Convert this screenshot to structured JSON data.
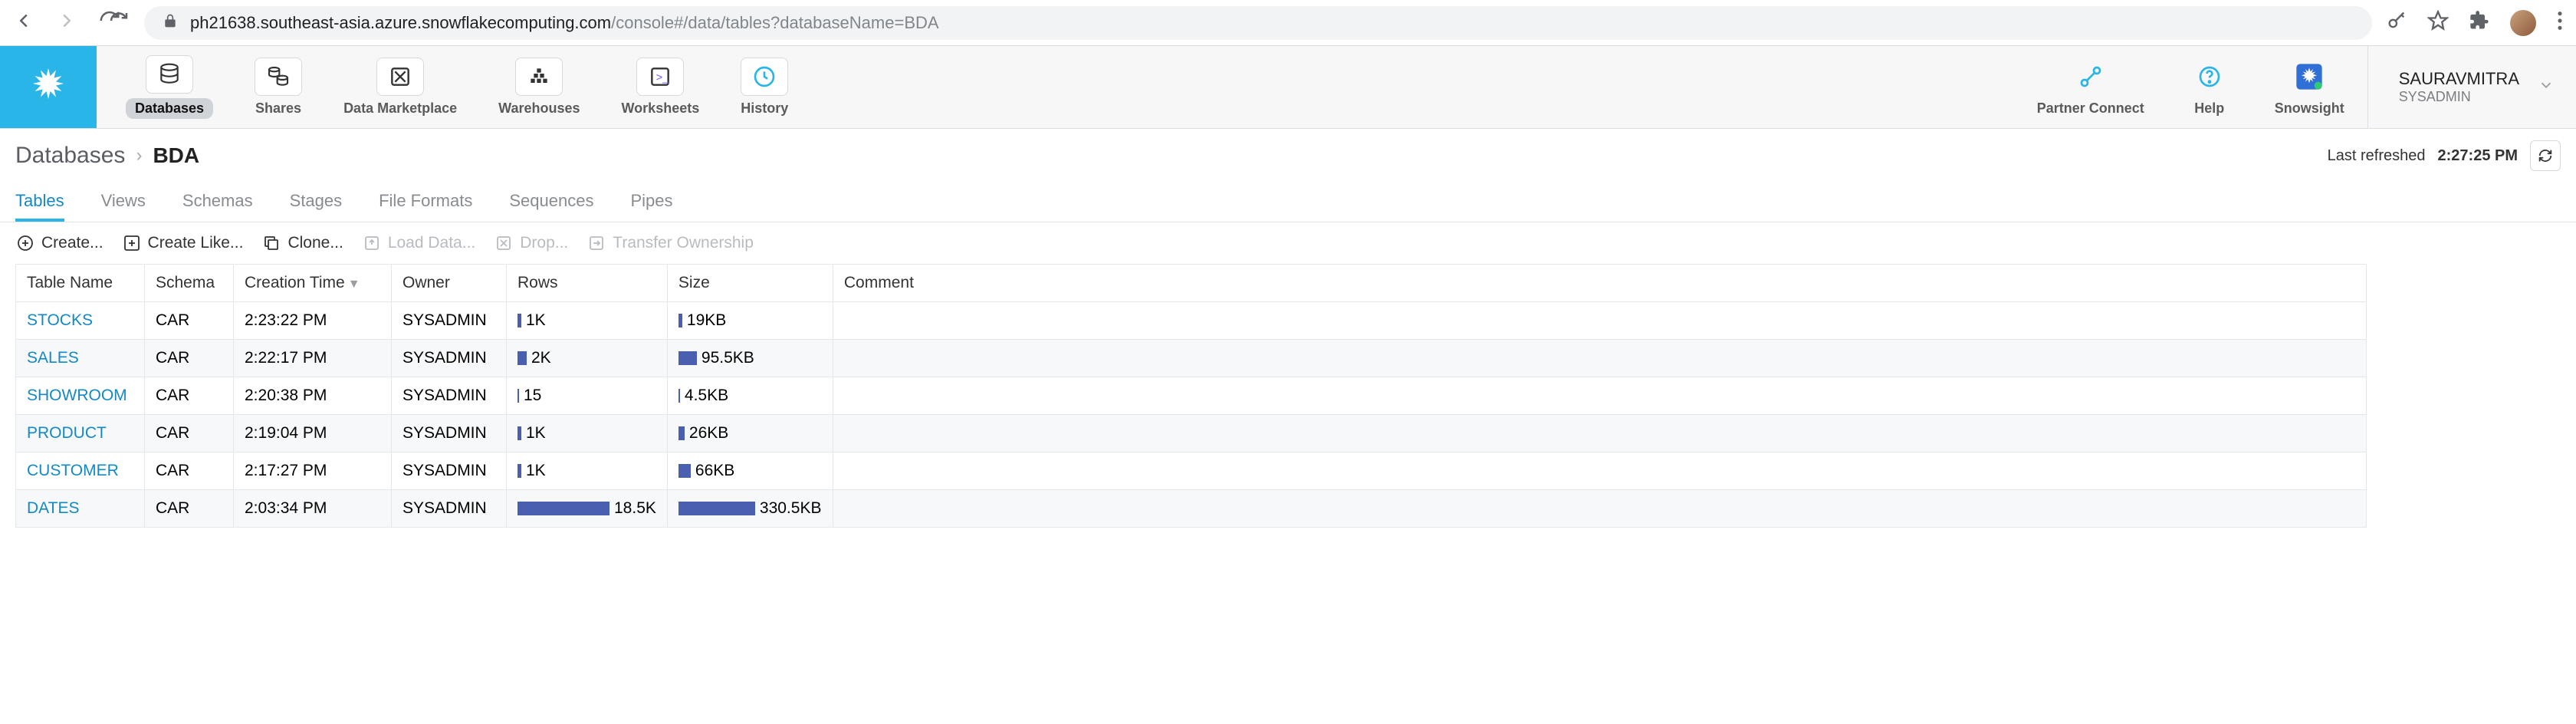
{
  "browser": {
    "url_host": "ph21638.southeast-asia.azure.snowflakecomputing.com",
    "url_path": "/console#/data/tables?databaseName=BDA"
  },
  "nav": {
    "items": [
      {
        "label": "Databases",
        "icon": "database-icon",
        "active": true
      },
      {
        "label": "Shares",
        "icon": "shares-icon"
      },
      {
        "label": "Data Marketplace",
        "icon": "marketplace-icon"
      },
      {
        "label": "Warehouses",
        "icon": "warehouse-icon"
      },
      {
        "label": "Worksheets",
        "icon": "worksheet-icon"
      },
      {
        "label": "History",
        "icon": "history-icon"
      }
    ],
    "right": [
      {
        "label": "Partner Connect",
        "icon": "partner-icon"
      },
      {
        "label": "Help",
        "icon": "help-icon"
      },
      {
        "label": "Snowsight",
        "icon": "snowsight-icon"
      }
    ]
  },
  "user": {
    "name": "SAURAVMITRA",
    "role": "SYSADMIN"
  },
  "breadcrumb": {
    "root": "Databases",
    "leaf": "BDA"
  },
  "refresh": {
    "label": "Last refreshed",
    "time": "2:27:25 PM"
  },
  "tabs": [
    "Tables",
    "Views",
    "Schemas",
    "Stages",
    "File Formats",
    "Sequences",
    "Pipes"
  ],
  "active_tab": 0,
  "actions": [
    {
      "label": "Create...",
      "icon": "plus-circle-icon",
      "disabled": false
    },
    {
      "label": "Create Like...",
      "icon": "plus-square-icon",
      "disabled": false
    },
    {
      "label": "Clone...",
      "icon": "clone-icon",
      "disabled": false
    },
    {
      "label": "Load Data...",
      "icon": "load-icon",
      "disabled": true
    },
    {
      "label": "Drop...",
      "icon": "drop-icon",
      "disabled": true
    },
    {
      "label": "Transfer Ownership",
      "icon": "transfer-icon",
      "disabled": true
    }
  ],
  "columns": [
    "Table Name",
    "Schema",
    "Creation Time",
    "Owner",
    "Rows",
    "Size",
    "Comment"
  ],
  "sort_column": 2,
  "rows": [
    {
      "name": "STOCKS",
      "schema": "CAR",
      "time": "2:23:22 PM",
      "owner": "SYSADMIN",
      "rows": "1K",
      "rows_bar": 5,
      "size": "19KB",
      "size_bar": 5,
      "comment": ""
    },
    {
      "name": "SALES",
      "schema": "CAR",
      "time": "2:22:17 PM",
      "owner": "SYSADMIN",
      "rows": "2K",
      "rows_bar": 12,
      "size": "95.5KB",
      "size_bar": 24,
      "comment": ""
    },
    {
      "name": "SHOWROOM",
      "schema": "CAR",
      "time": "2:20:38 PM",
      "owner": "SYSADMIN",
      "rows": "15",
      "rows_bar": 2,
      "size": "4.5KB",
      "size_bar": 2,
      "comment": ""
    },
    {
      "name": "PRODUCT",
      "schema": "CAR",
      "time": "2:19:04 PM",
      "owner": "SYSADMIN",
      "rows": "1K",
      "rows_bar": 5,
      "size": "26KB",
      "size_bar": 8,
      "comment": ""
    },
    {
      "name": "CUSTOMER",
      "schema": "CAR",
      "time": "2:17:27 PM",
      "owner": "SYSADMIN",
      "rows": "1K",
      "rows_bar": 5,
      "size": "66KB",
      "size_bar": 16,
      "comment": ""
    },
    {
      "name": "DATES",
      "schema": "CAR",
      "time": "2:03:34 PM",
      "owner": "SYSADMIN",
      "rows": "18.5K",
      "rows_bar": 120,
      "size": "330.5KB",
      "size_bar": 100,
      "comment": ""
    }
  ]
}
